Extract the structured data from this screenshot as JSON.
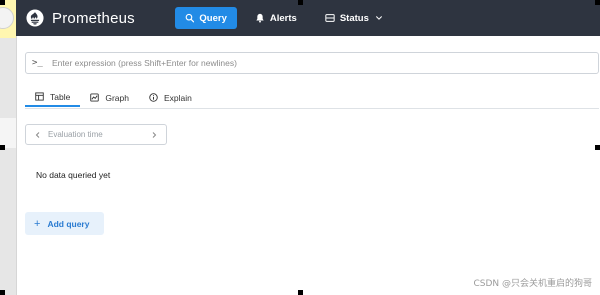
{
  "navbar": {
    "brand": "Prometheus",
    "query_label": "Query",
    "alerts_label": "Alerts",
    "status_label": "Status"
  },
  "expression": {
    "prompt": ">_",
    "placeholder": "Enter expression (press Shift+Enter for newlines)"
  },
  "tabs": [
    {
      "label": "Table",
      "icon": "table-icon",
      "active": true
    },
    {
      "label": "Graph",
      "icon": "graph-icon",
      "active": false
    },
    {
      "label": "Explain",
      "icon": "info-icon",
      "active": false
    }
  ],
  "eval_time": {
    "placeholder": "Evaluation time"
  },
  "results": {
    "empty_message": "No data queried yet"
  },
  "add_query_label": "Add query",
  "watermark": "CSDN @只会关机重启的狗哥",
  "colors": {
    "navbar_bg": "#2e3440",
    "accent": "#228be6",
    "add_query_bg": "#e7f1fb"
  }
}
